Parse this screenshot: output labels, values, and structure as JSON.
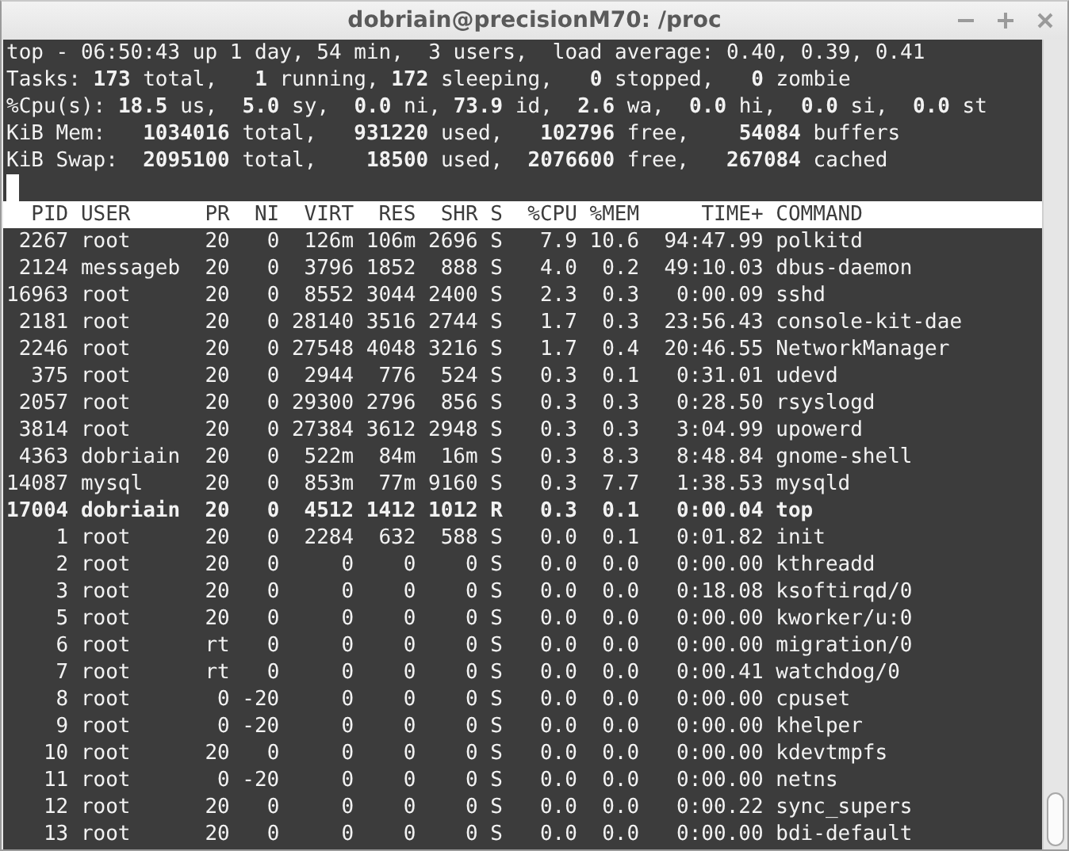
{
  "window": {
    "title": "dobriain@precisionM70: /proc"
  },
  "summary": [
    "top - 06:50:43 up 1 day, 54 min,  3 users,  load average: 0.40, 0.39, 0.41",
    "Tasks: **173** total,   **1** running, **172** sleeping,   **0** stopped,   **0** zombie",
    "%Cpu(s): **18.5** us,  **5.0** sy,  **0.0** ni, **73.9** id,  **2.6** wa,  **0.0** hi,  **0.0** si,  **0.0** st",
    "KiB Mem:   **1034016** total,   **931220** used,   **102796** free,    **54084** buffers",
    "KiB Swap:  **2095100** total,    **18500** used,  **2076600** free,   **267084** cached"
  ],
  "columns": [
    "PID",
    "USER",
    "PR",
    "NI",
    "VIRT",
    "RES",
    "SHR",
    "S",
    "%CPU",
    "%MEM",
    "TIME+",
    "COMMAND"
  ],
  "processes": [
    {
      "cells": [
        "2267",
        "root",
        "20",
        "0",
        "126m",
        "106m",
        "2696",
        "S",
        "7.9",
        "10.6",
        "94:47.99",
        "polkitd"
      ],
      "highlighted": false
    },
    {
      "cells": [
        "2124",
        "messageb",
        "20",
        "0",
        "3796",
        "1852",
        "888",
        "S",
        "4.0",
        "0.2",
        "49:10.03",
        "dbus-daemon"
      ],
      "highlighted": false
    },
    {
      "cells": [
        "16963",
        "root",
        "20",
        "0",
        "8552",
        "3044",
        "2400",
        "S",
        "2.3",
        "0.3",
        "0:00.09",
        "sshd"
      ],
      "highlighted": false
    },
    {
      "cells": [
        "2181",
        "root",
        "20",
        "0",
        "28140",
        "3516",
        "2744",
        "S",
        "1.7",
        "0.3",
        "23:56.43",
        "console-kit-dae"
      ],
      "highlighted": false
    },
    {
      "cells": [
        "2246",
        "root",
        "20",
        "0",
        "27548",
        "4048",
        "3216",
        "S",
        "1.7",
        "0.4",
        "20:46.55",
        "NetworkManager"
      ],
      "highlighted": false
    },
    {
      "cells": [
        "375",
        "root",
        "20",
        "0",
        "2944",
        "776",
        "524",
        "S",
        "0.3",
        "0.1",
        "0:31.01",
        "udevd"
      ],
      "highlighted": false
    },
    {
      "cells": [
        "2057",
        "root",
        "20",
        "0",
        "29300",
        "2796",
        "856",
        "S",
        "0.3",
        "0.3",
        "0:28.50",
        "rsyslogd"
      ],
      "highlighted": false
    },
    {
      "cells": [
        "3814",
        "root",
        "20",
        "0",
        "27384",
        "3612",
        "2948",
        "S",
        "0.3",
        "0.3",
        "3:04.99",
        "upowerd"
      ],
      "highlighted": false
    },
    {
      "cells": [
        "4363",
        "dobriain",
        "20",
        "0",
        "522m",
        "84m",
        "16m",
        "S",
        "0.3",
        "8.3",
        "8:48.84",
        "gnome-shell"
      ],
      "highlighted": false
    },
    {
      "cells": [
        "14087",
        "mysql",
        "20",
        "0",
        "853m",
        "77m",
        "9160",
        "S",
        "0.3",
        "7.7",
        "1:38.53",
        "mysqld"
      ],
      "highlighted": false
    },
    {
      "cells": [
        "17004",
        "dobriain",
        "20",
        "0",
        "4512",
        "1412",
        "1012",
        "R",
        "0.3",
        "0.1",
        "0:00.04",
        "top"
      ],
      "highlighted": true
    },
    {
      "cells": [
        "1",
        "root",
        "20",
        "0",
        "2284",
        "632",
        "588",
        "S",
        "0.0",
        "0.1",
        "0:01.82",
        "init"
      ],
      "highlighted": false
    },
    {
      "cells": [
        "2",
        "root",
        "20",
        "0",
        "0",
        "0",
        "0",
        "S",
        "0.0",
        "0.0",
        "0:00.00",
        "kthreadd"
      ],
      "highlighted": false
    },
    {
      "cells": [
        "3",
        "root",
        "20",
        "0",
        "0",
        "0",
        "0",
        "S",
        "0.0",
        "0.0",
        "0:18.08",
        "ksoftirqd/0"
      ],
      "highlighted": false
    },
    {
      "cells": [
        "5",
        "root",
        "20",
        "0",
        "0",
        "0",
        "0",
        "S",
        "0.0",
        "0.0",
        "0:00.00",
        "kworker/u:0"
      ],
      "highlighted": false
    },
    {
      "cells": [
        "6",
        "root",
        "rt",
        "0",
        "0",
        "0",
        "0",
        "S",
        "0.0",
        "0.0",
        "0:00.00",
        "migration/0"
      ],
      "highlighted": false
    },
    {
      "cells": [
        "7",
        "root",
        "rt",
        "0",
        "0",
        "0",
        "0",
        "S",
        "0.0",
        "0.0",
        "0:00.41",
        "watchdog/0"
      ],
      "highlighted": false
    },
    {
      "cells": [
        "8",
        "root",
        "0",
        "-20",
        "0",
        "0",
        "0",
        "S",
        "0.0",
        "0.0",
        "0:00.00",
        "cpuset"
      ],
      "highlighted": false
    },
    {
      "cells": [
        "9",
        "root",
        "0",
        "-20",
        "0",
        "0",
        "0",
        "S",
        "0.0",
        "0.0",
        "0:00.00",
        "khelper"
      ],
      "highlighted": false
    },
    {
      "cells": [
        "10",
        "root",
        "20",
        "0",
        "0",
        "0",
        "0",
        "S",
        "0.0",
        "0.0",
        "0:00.00",
        "kdevtmpfs"
      ],
      "highlighted": false
    },
    {
      "cells": [
        "11",
        "root",
        "0",
        "-20",
        "0",
        "0",
        "0",
        "S",
        "0.0",
        "0.0",
        "0:00.00",
        "netns"
      ],
      "highlighted": false
    },
    {
      "cells": [
        "12",
        "root",
        "20",
        "0",
        "0",
        "0",
        "0",
        "S",
        "0.0",
        "0.0",
        "0:00.22",
        "sync_supers"
      ],
      "highlighted": false
    },
    {
      "cells": [
        "13",
        "root",
        "20",
        "0",
        "0",
        "0",
        "0",
        "S",
        "0.0",
        "0.0",
        "0:00.00",
        "bdi-default"
      ],
      "highlighted": false
    }
  ]
}
